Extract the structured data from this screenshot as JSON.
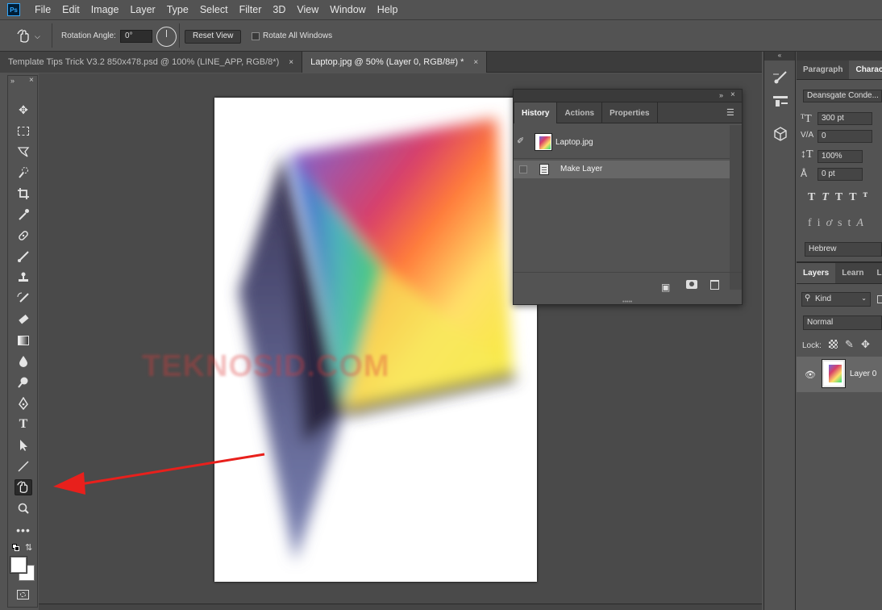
{
  "app": {
    "logo": "Ps",
    "accent": "#31a8ff"
  },
  "menu": [
    "File",
    "Edit",
    "Image",
    "Layer",
    "Type",
    "Select",
    "Filter",
    "3D",
    "View",
    "Window",
    "Help"
  ],
  "options": {
    "rotation_label": "Rotation Angle:",
    "rotation_value": "0°",
    "reset_button": "Reset View",
    "rotate_all_label": "Rotate All Windows"
  },
  "doc_tabs": [
    {
      "label": "Template Tips Trick V3.2 850x478.psd @ 100% (LINE_APP, RGB/8*)",
      "close": "×"
    },
    {
      "label": "Laptop.jpg @ 50% (Layer 0, RGB/8#) *",
      "close": "×"
    }
  ],
  "watermark": "TEKNOSID.COM",
  "history_panel": {
    "tabs": [
      "History",
      "Actions",
      "Properties"
    ],
    "snapshot_label": "Laptop.jpg",
    "steps": [
      "Make Layer"
    ]
  },
  "character_panel": {
    "tabs": [
      "Paragraph",
      "Characte"
    ],
    "font": "Deansgate Conde...",
    "size": "300 pt",
    "kerning": "0",
    "vscale": "100%",
    "baseline": "0 pt",
    "language": "Hebrew"
  },
  "layers_panel": {
    "tabs": [
      "Layers",
      "Learn",
      "Li"
    ],
    "kind_filter": "Kind",
    "blend_mode": "Normal",
    "lock_label": "Lock:",
    "layers": [
      {
        "name": "Layer 0"
      }
    ]
  },
  "colors": {
    "arrow": "#e8201c",
    "bg": "#535353",
    "panel_dark": "#424242"
  }
}
